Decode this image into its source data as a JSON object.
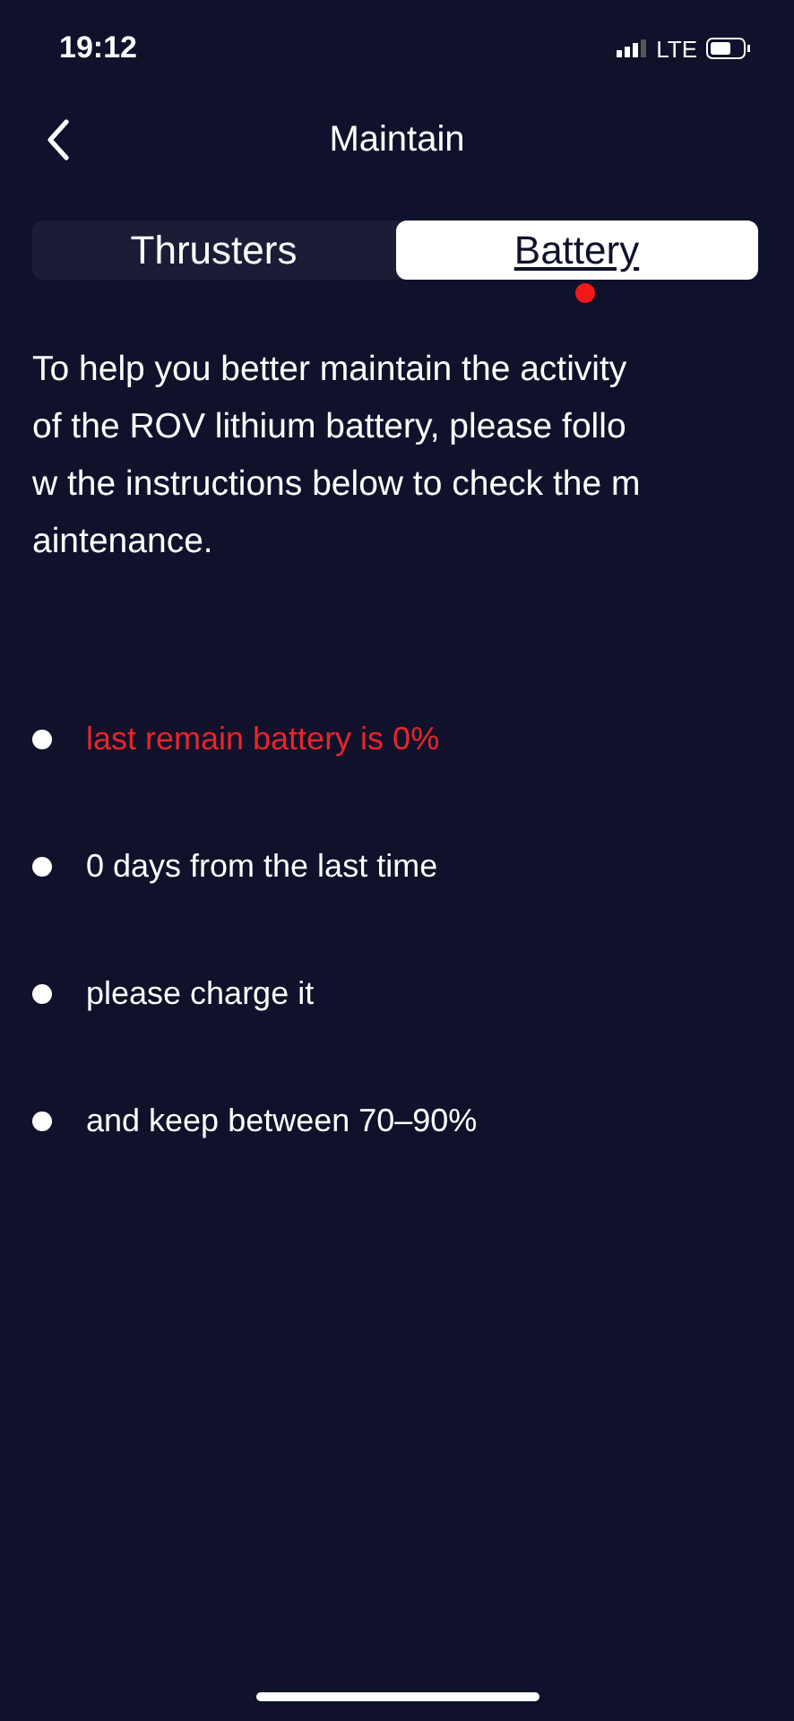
{
  "status_bar": {
    "time": "19:12",
    "network": "LTE"
  },
  "header": {
    "title": "Maintain"
  },
  "tabs": [
    {
      "label": "Thrusters",
      "selected": false
    },
    {
      "label": "Battery",
      "selected": true
    }
  ],
  "intro_lines": [
    "To help you better maintain the activity",
    "of the ROV lithium battery, please follo",
    "w the instructions below to check the m",
    "aintenance."
  ],
  "items": [
    {
      "text": "last remain battery is 0%",
      "color": "#e8262b"
    },
    {
      "text": "0 days from the last time",
      "color": "#ffffff"
    },
    {
      "text": "please charge it",
      "color": "#ffffff"
    },
    {
      "text": "and keep between 70–90%",
      "color": "#ffffff"
    }
  ]
}
